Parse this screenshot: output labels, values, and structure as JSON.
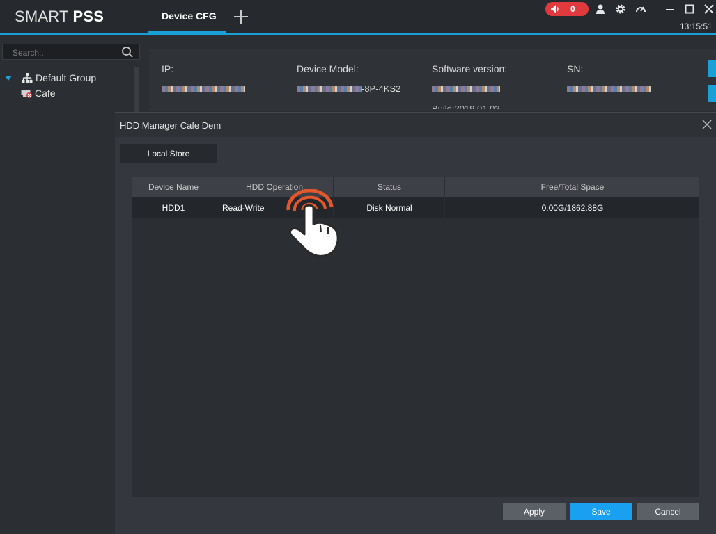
{
  "app": {
    "logo_light": "SMART ",
    "logo_bold": "PSS",
    "active_tab": "Device CFG",
    "alarm_count": "0",
    "clock": "13:15:51",
    "colors": {
      "accent": "#1aa0d8",
      "alarm": "#e0393e",
      "save_button": "#1aa0f0"
    }
  },
  "sidebar": {
    "search_placeholder": "Search..",
    "group_label": "Default Group",
    "device_label": "Cafe"
  },
  "device_info": {
    "ip_label": "IP:",
    "model_label": "Device Model:",
    "model_value_suffix": "-8P-4KS2",
    "software_label": "Software version:",
    "build_text": "Build:2019.01.02",
    "sn_label": "SN:"
  },
  "modal": {
    "title": "HDD Manager Cafe Dem",
    "subtab": "Local Store",
    "columns": [
      "Device Name",
      "HDD Operation",
      "Status",
      "Free/Total Space"
    ],
    "rows": [
      {
        "device_name": "HDD1",
        "hdd_operation": "Read-Write",
        "status": "Disk Normal",
        "space": "0.00G/1862.88G"
      }
    ],
    "buttons": {
      "apply": "Apply",
      "save": "Save",
      "cancel": "Cancel"
    }
  }
}
